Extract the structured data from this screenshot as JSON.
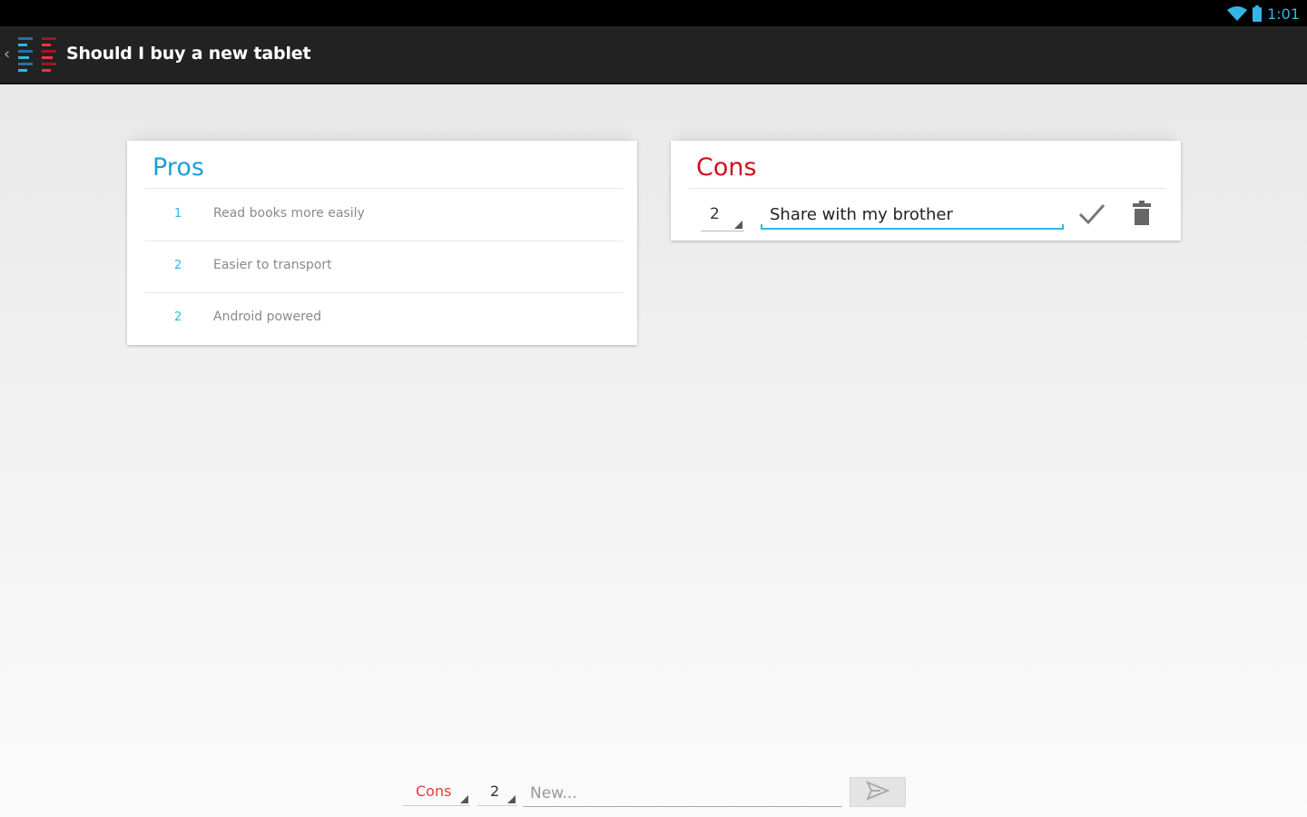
{
  "status_bar": {
    "time": "1:01",
    "icons": [
      "wifi-icon",
      "battery-icon"
    ],
    "accent": "#33b5e5"
  },
  "action_bar": {
    "title": "Should I buy a new tablet",
    "icons": [
      "up-caret-icon",
      "app-icon"
    ]
  },
  "pros": {
    "title": "Pros",
    "color": "#1ba1d6",
    "items": [
      {
        "weight": "1",
        "text": "Read books more easily"
      },
      {
        "weight": "2",
        "text": "Easier to transport"
      },
      {
        "weight": "2",
        "text": "Android powered"
      }
    ]
  },
  "cons": {
    "title": "Cons",
    "color": "#d0101c",
    "editing": {
      "weight": "2",
      "text": "Share with my brother"
    },
    "icons": [
      "checkmark-icon",
      "trash-icon"
    ]
  },
  "new_item": {
    "type": "Cons",
    "weight": "2",
    "placeholder": "New...",
    "send_icon": "send-icon"
  }
}
